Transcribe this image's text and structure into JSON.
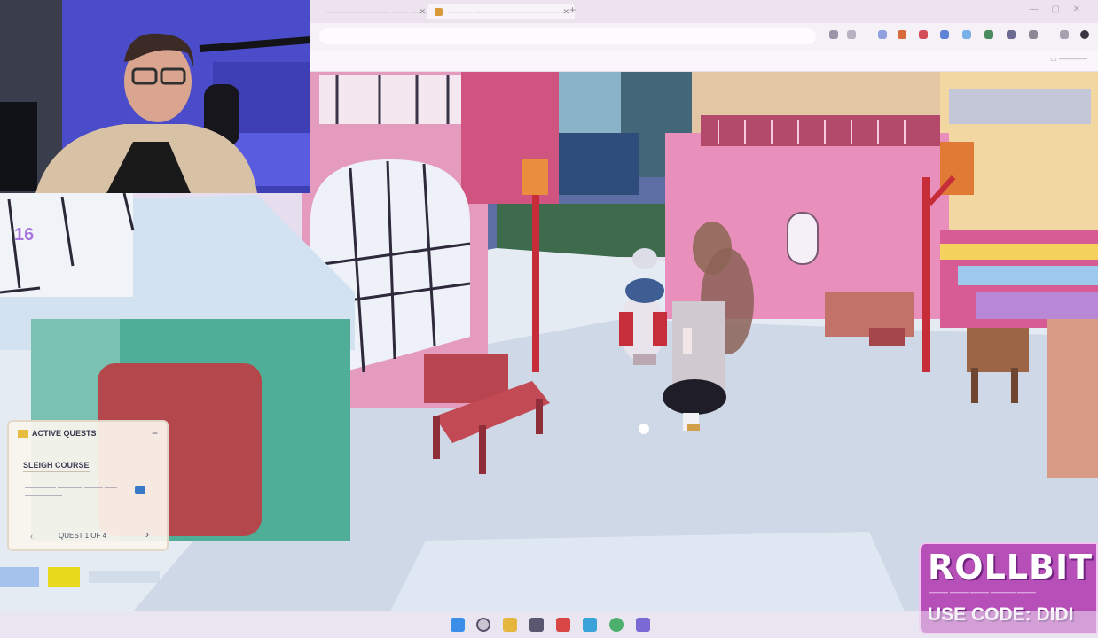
{
  "browser": {
    "tabs": [
      {
        "label": "———————— —— ——",
        "active": false
      },
      {
        "label": "——— ——————————————",
        "active": true
      }
    ],
    "new_tab": "+",
    "window_controls": "— ▢ ✕",
    "address": "",
    "bookmarks_right": "▭ ————"
  },
  "hud": {
    "player_level": "16",
    "quest_panel": {
      "title": "ACTIVE QUESTS",
      "close": "−",
      "subtitle": "SLEIGH COURSE",
      "task": "————— ———— ——— —— ——————",
      "footer_left": "‹",
      "footer": "QUEST 1 OF 4",
      "footer_right": "›"
    }
  },
  "sponsor": {
    "brand": "ROLLBIT",
    "tagline": "——— ——— ——— ———— ———",
    "code_text": "USE CODE: DIDI"
  },
  "taskbar": {
    "icons": [
      "windows-start-icon",
      "search-icon",
      "file-explorer-icon",
      "app-icon-1",
      "app-icon-2",
      "app-icon-3",
      "app-icon-4"
    ]
  },
  "colors": {
    "sky_lavender": "#e5d9f2",
    "snow": "#e8eef5",
    "pink_building": "#e87eaa",
    "teal_hut": "#3faa94",
    "red_bench": "#b43c48",
    "sponsor_purple": "#b64fb7",
    "webcam_blue": "#4d4fd0"
  }
}
